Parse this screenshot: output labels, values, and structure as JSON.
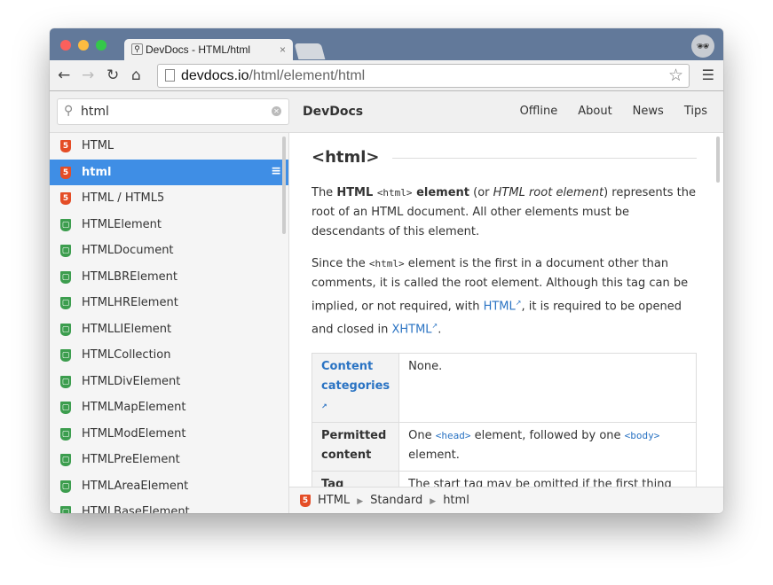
{
  "browser": {
    "tab_title": "DevDocs - HTML/html",
    "url_host": "devdocs.io",
    "url_path": "/html/element/html",
    "tab_close": "×"
  },
  "app": {
    "search_value": "html",
    "brand": "DevDocs",
    "links": [
      "Offline",
      "About",
      "News",
      "Tips"
    ]
  },
  "sidebar": {
    "items": [
      {
        "label": "HTML",
        "icon": "html5",
        "selected": false
      },
      {
        "label": "html",
        "icon": "html5",
        "selected": true
      },
      {
        "label": "HTML / HTML5",
        "icon": "html5",
        "selected": false
      },
      {
        "label": "HTMLElement",
        "icon": "dom"
      },
      {
        "label": "HTMLDocument",
        "icon": "dom"
      },
      {
        "label": "HTMLBRElement",
        "icon": "dom"
      },
      {
        "label": "HTMLHRElement",
        "icon": "dom"
      },
      {
        "label": "HTMLLIElement",
        "icon": "dom"
      },
      {
        "label": "HTMLCollection",
        "icon": "dom"
      },
      {
        "label": "HTMLDivElement",
        "icon": "dom"
      },
      {
        "label": "HTMLMapElement",
        "icon": "dom"
      },
      {
        "label": "HTMLModElement",
        "icon": "dom"
      },
      {
        "label": "HTMLPreElement",
        "icon": "dom"
      },
      {
        "label": "HTMLAreaElement",
        "icon": "dom"
      },
      {
        "label": "HTMLBaseElement",
        "icon": "dom"
      }
    ]
  },
  "content": {
    "title": "<html>",
    "p1": {
      "a": "The ",
      "b": "HTML ",
      "code": "<html>",
      "c": " element",
      "d": " (or ",
      "e": "HTML root element",
      "f": ") represents the root of an HTML document. All other elements must be descendants of this element."
    },
    "p2": {
      "a": "Since the ",
      "code": "<html>",
      "b": " element is the first in a document other than comments, it is called the root element. Although this tag can be implied, or not required, with ",
      "link1": "HTML",
      "c": ", it is required to be opened and closed in ",
      "link2": "XHTML",
      "d": "."
    },
    "table": [
      {
        "h": "Content categories",
        "v": "None."
      },
      {
        "h": "Permitted content",
        "v1": "One ",
        "c1": "<head>",
        "v2": " element, followed by one ",
        "c2": "<body>",
        "v3": " element."
      },
      {
        "h": "Tag",
        "v": "The start tag may be omitted if the first thing inside"
      }
    ]
  },
  "footer": {
    "crumbs": [
      "HTML",
      "Standard",
      "html"
    ]
  },
  "colors": {
    "accent": "#3f8ee5",
    "html5": "#e44d26",
    "dom": "#3c9d4e",
    "link": "#2a73c3"
  }
}
